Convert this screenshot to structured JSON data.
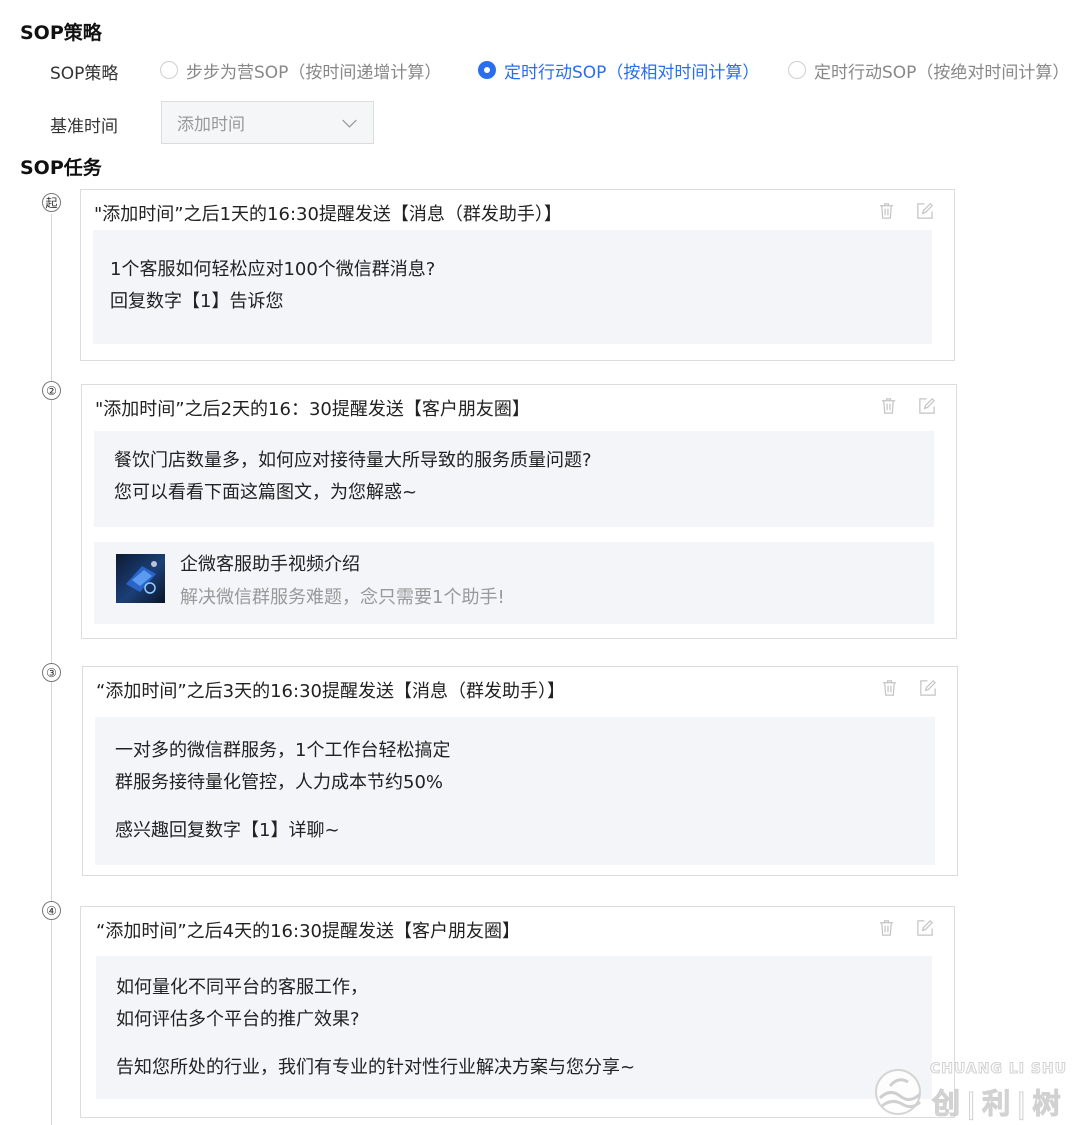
{
  "strategy_section": {
    "title": "SOP策略",
    "row_label": "SOP策略",
    "options": [
      {
        "label": "步步为营SOP（按时间递增计算）",
        "checked": false
      },
      {
        "label": "定时行动SOP（按相对时间计算）",
        "checked": true
      },
      {
        "label": "定时行动SOP（按绝对时间计算）",
        "checked": false
      }
    ],
    "base_time_label": "基准时间",
    "base_time_value": "添加时间"
  },
  "task_section": {
    "title": "SOP任务",
    "steps": [
      {
        "marker": "起",
        "title": "\"添加时间”之后1天的16:30提醒发送【消息（群发助手）】",
        "message_lines": [
          "1个客服如何轻松应对100个微信群消息?",
          "回复数字【1】告诉您"
        ]
      },
      {
        "marker": "②",
        "title": "\"添加时间”之后2天的16：30提醒发送【客户朋友圈】",
        "message_lines": [
          "餐饮门店数量多，如何应对接待量大所导致的服务质量问题?",
          "您可以看看下面这篇图文，为您解惑~"
        ],
        "link": {
          "title": "企微客服助手视频介绍",
          "desc": "解决微信群服务难题，念只需要1个助手!"
        }
      },
      {
        "marker": "③",
        "title": "“添加时间”之后3天的16:30提醒发送【消息（群发助手）】",
        "message_lines": [
          "一对多的微信群服务，1个工作台轻松搞定",
          "群服务接待量化管控，人力成本节约50%",
          "感兴趣回复数字【1】详聊~"
        ]
      },
      {
        "marker": "④",
        "title": "“添加时间”之后4天的16:30提醒发送【客户朋友圈】",
        "message_lines": [
          "如何量化不同平台的客服工作，",
          "如何评估多个平台的推广效果?",
          "告知您所处的行业，我们有专业的针对性行业解决方案与您分享~"
        ]
      }
    ]
  },
  "watermark": {
    "en": "CHUANG LI SHU",
    "cn": "创|利|树"
  },
  "colors": {
    "accent": "#2a6ef0",
    "message_bg": "#f4f5f9",
    "border": "#dcdcdc",
    "muted": "#999999"
  },
  "icons": {
    "delete": "trash-icon",
    "edit": "edit-icon",
    "dropdown": "chevron-down-icon"
  }
}
